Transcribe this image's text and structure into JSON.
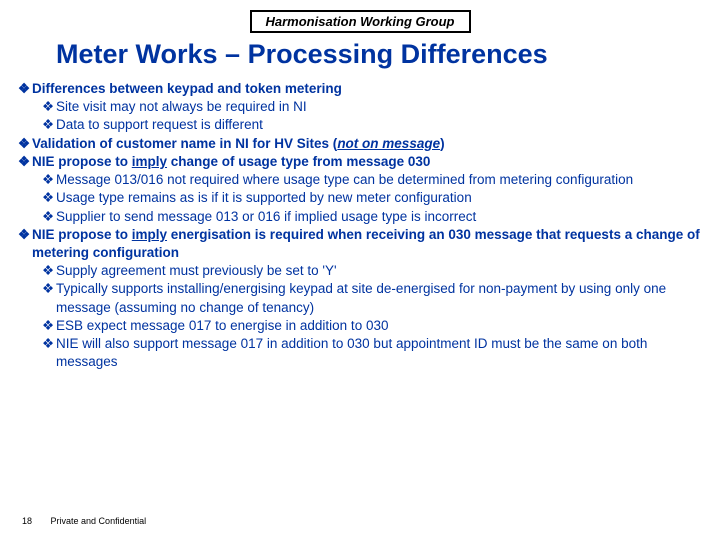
{
  "header": "Harmonisation Working Group",
  "title": "Meter Works – Processing Differences",
  "bullet_glyph": "❖",
  "items": [
    {
      "lvl": 1,
      "bold": true,
      "parts": [
        {
          "t": "Differences between keypad and token metering"
        }
      ]
    },
    {
      "lvl": 2,
      "bold": false,
      "parts": [
        {
          "t": "Site visit may not always be required in NI"
        }
      ]
    },
    {
      "lvl": 2,
      "bold": false,
      "parts": [
        {
          "t": "Data to support request is different"
        }
      ]
    },
    {
      "lvl": 1,
      "bold": true,
      "parts": [
        {
          "t": "Validation of customer name in NI for HV Sites ("
        },
        {
          "t": "not on message",
          "iu": true
        },
        {
          "t": ")"
        }
      ]
    },
    {
      "lvl": 1,
      "bold": true,
      "parts": [
        {
          "t": "NIE propose to "
        },
        {
          "t": "imply",
          "u": true
        },
        {
          "t": " change of usage type from message 030"
        }
      ]
    },
    {
      "lvl": 2,
      "bold": false,
      "parts": [
        {
          "t": "Message 013/016 not required where usage type can be determined from metering configuration"
        }
      ]
    },
    {
      "lvl": 2,
      "bold": false,
      "parts": [
        {
          "t": "Usage type remains as is if it is supported by new meter configuration"
        }
      ]
    },
    {
      "lvl": 2,
      "bold": false,
      "parts": [
        {
          "t": "Supplier to send message 013 or 016 if implied usage type is incorrect"
        }
      ]
    },
    {
      "lvl": 1,
      "bold": true,
      "parts": [
        {
          "t": "NIE propose to "
        },
        {
          "t": "imply",
          "u": true
        },
        {
          "t": " energisation is required when receiving an 030 message that requests a change of metering configuration"
        }
      ]
    },
    {
      "lvl": 2,
      "bold": false,
      "parts": [
        {
          "t": "Supply agreement must previously be set to 'Y'"
        }
      ]
    },
    {
      "lvl": 2,
      "bold": false,
      "parts": [
        {
          "t": "Typically supports installing/energising keypad at site de-energised for non-payment by using only one message (assuming no change of tenancy)"
        }
      ]
    },
    {
      "lvl": 2,
      "bold": false,
      "parts": [
        {
          "t": "ESB expect message 017 to energise in addition to 030"
        }
      ]
    },
    {
      "lvl": 2,
      "bold": false,
      "parts": [
        {
          "t": "NIE will also support message 017 in addition to 030 but appointment ID must be the same on both messages"
        }
      ]
    }
  ],
  "footer": {
    "page": "18",
    "label": "Private and Confidential"
  }
}
